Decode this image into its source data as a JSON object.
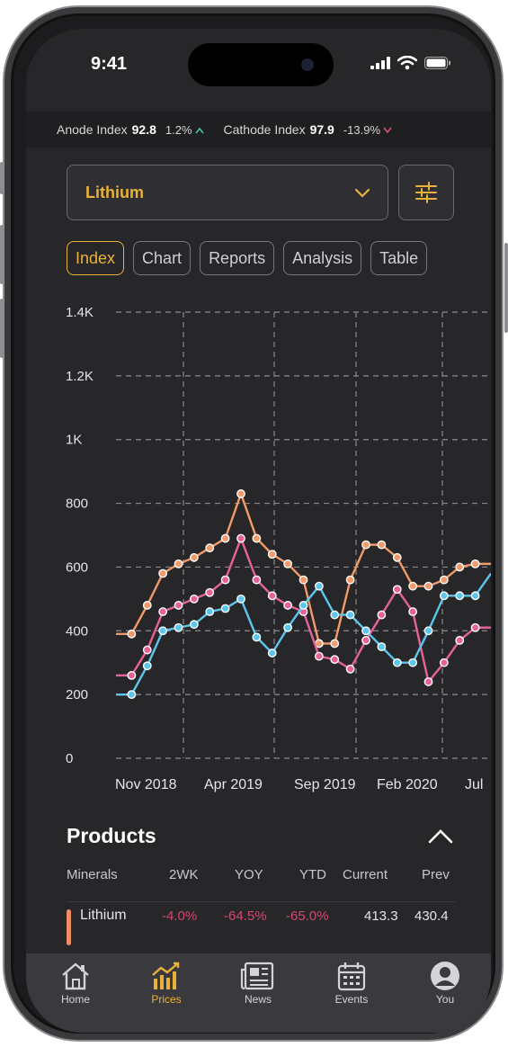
{
  "status": {
    "time": "9:41"
  },
  "ticker": [
    {
      "name": "Anode Index",
      "value": "92.8",
      "change": "1.2%",
      "direction": "up"
    },
    {
      "name": "Cathode Index",
      "value": "97.9",
      "change": "-13.9%",
      "direction": "down"
    }
  ],
  "selector": {
    "value": "Lithium"
  },
  "tabs": [
    {
      "label": "Index",
      "active": true
    },
    {
      "label": "Chart",
      "active": false
    },
    {
      "label": "Reports",
      "active": false
    },
    {
      "label": "Analysis",
      "active": false
    },
    {
      "label": "Table",
      "active": false
    }
  ],
  "colors": {
    "accent": "#e9b23a",
    "orange": "#f29a6a",
    "pink": "#e8629a",
    "blue": "#5cc6ec",
    "negative": "#d5476f"
  },
  "chart_data": {
    "type": "line",
    "ylim": [
      0,
      1400
    ],
    "y_ticks": [
      "0",
      "200",
      "400",
      "600",
      "800",
      "1K",
      "1.2K",
      "1.4K"
    ],
    "y_tick_values": [
      0,
      200,
      400,
      600,
      800,
      1000,
      1200,
      1400
    ],
    "x_ticks": [
      "Nov 2018",
      "Apr 2019",
      "Sep 2019",
      "Feb 2020",
      "Jul"
    ],
    "grid": true,
    "series": [
      {
        "color": "orange",
        "values": [
          390,
          390,
          480,
          580,
          610,
          630,
          660,
          690,
          830,
          690,
          640,
          610,
          560,
          360,
          360,
          560,
          670,
          670,
          630,
          540,
          540,
          560,
          600,
          610,
          610
        ]
      },
      {
        "color": "pink",
        "values": [
          260,
          260,
          340,
          460,
          480,
          500,
          520,
          560,
          690,
          560,
          510,
          480,
          460,
          320,
          310,
          280,
          370,
          450,
          530,
          460,
          240,
          300,
          370,
          410,
          410
        ]
      },
      {
        "color": "blue",
        "values": [
          200,
          200,
          290,
          400,
          410,
          420,
          460,
          470,
          500,
          380,
          330,
          410,
          480,
          540,
          450,
          450,
          400,
          350,
          300,
          300,
          400,
          510,
          510,
          510,
          580
        ]
      }
    ]
  },
  "products": {
    "title": "Products",
    "columns": [
      "Minerals",
      "2WK",
      "YOY",
      "YTD",
      "Current",
      "Prev"
    ],
    "rows": [
      {
        "mineral": "Lithium",
        "wk2": "-4.0%",
        "yoy": "-64.5%",
        "ytd": "-65.0%",
        "current": "413.3",
        "prev": "430.4"
      }
    ]
  },
  "nav": [
    {
      "label": "Home",
      "icon": "home-icon",
      "active": false
    },
    {
      "label": "Prices",
      "icon": "prices-icon",
      "active": true
    },
    {
      "label": "News",
      "icon": "news-icon",
      "active": false
    },
    {
      "label": "Events",
      "icon": "calendar-icon",
      "active": false
    },
    {
      "label": "You",
      "icon": "user-icon",
      "active": false
    }
  ]
}
